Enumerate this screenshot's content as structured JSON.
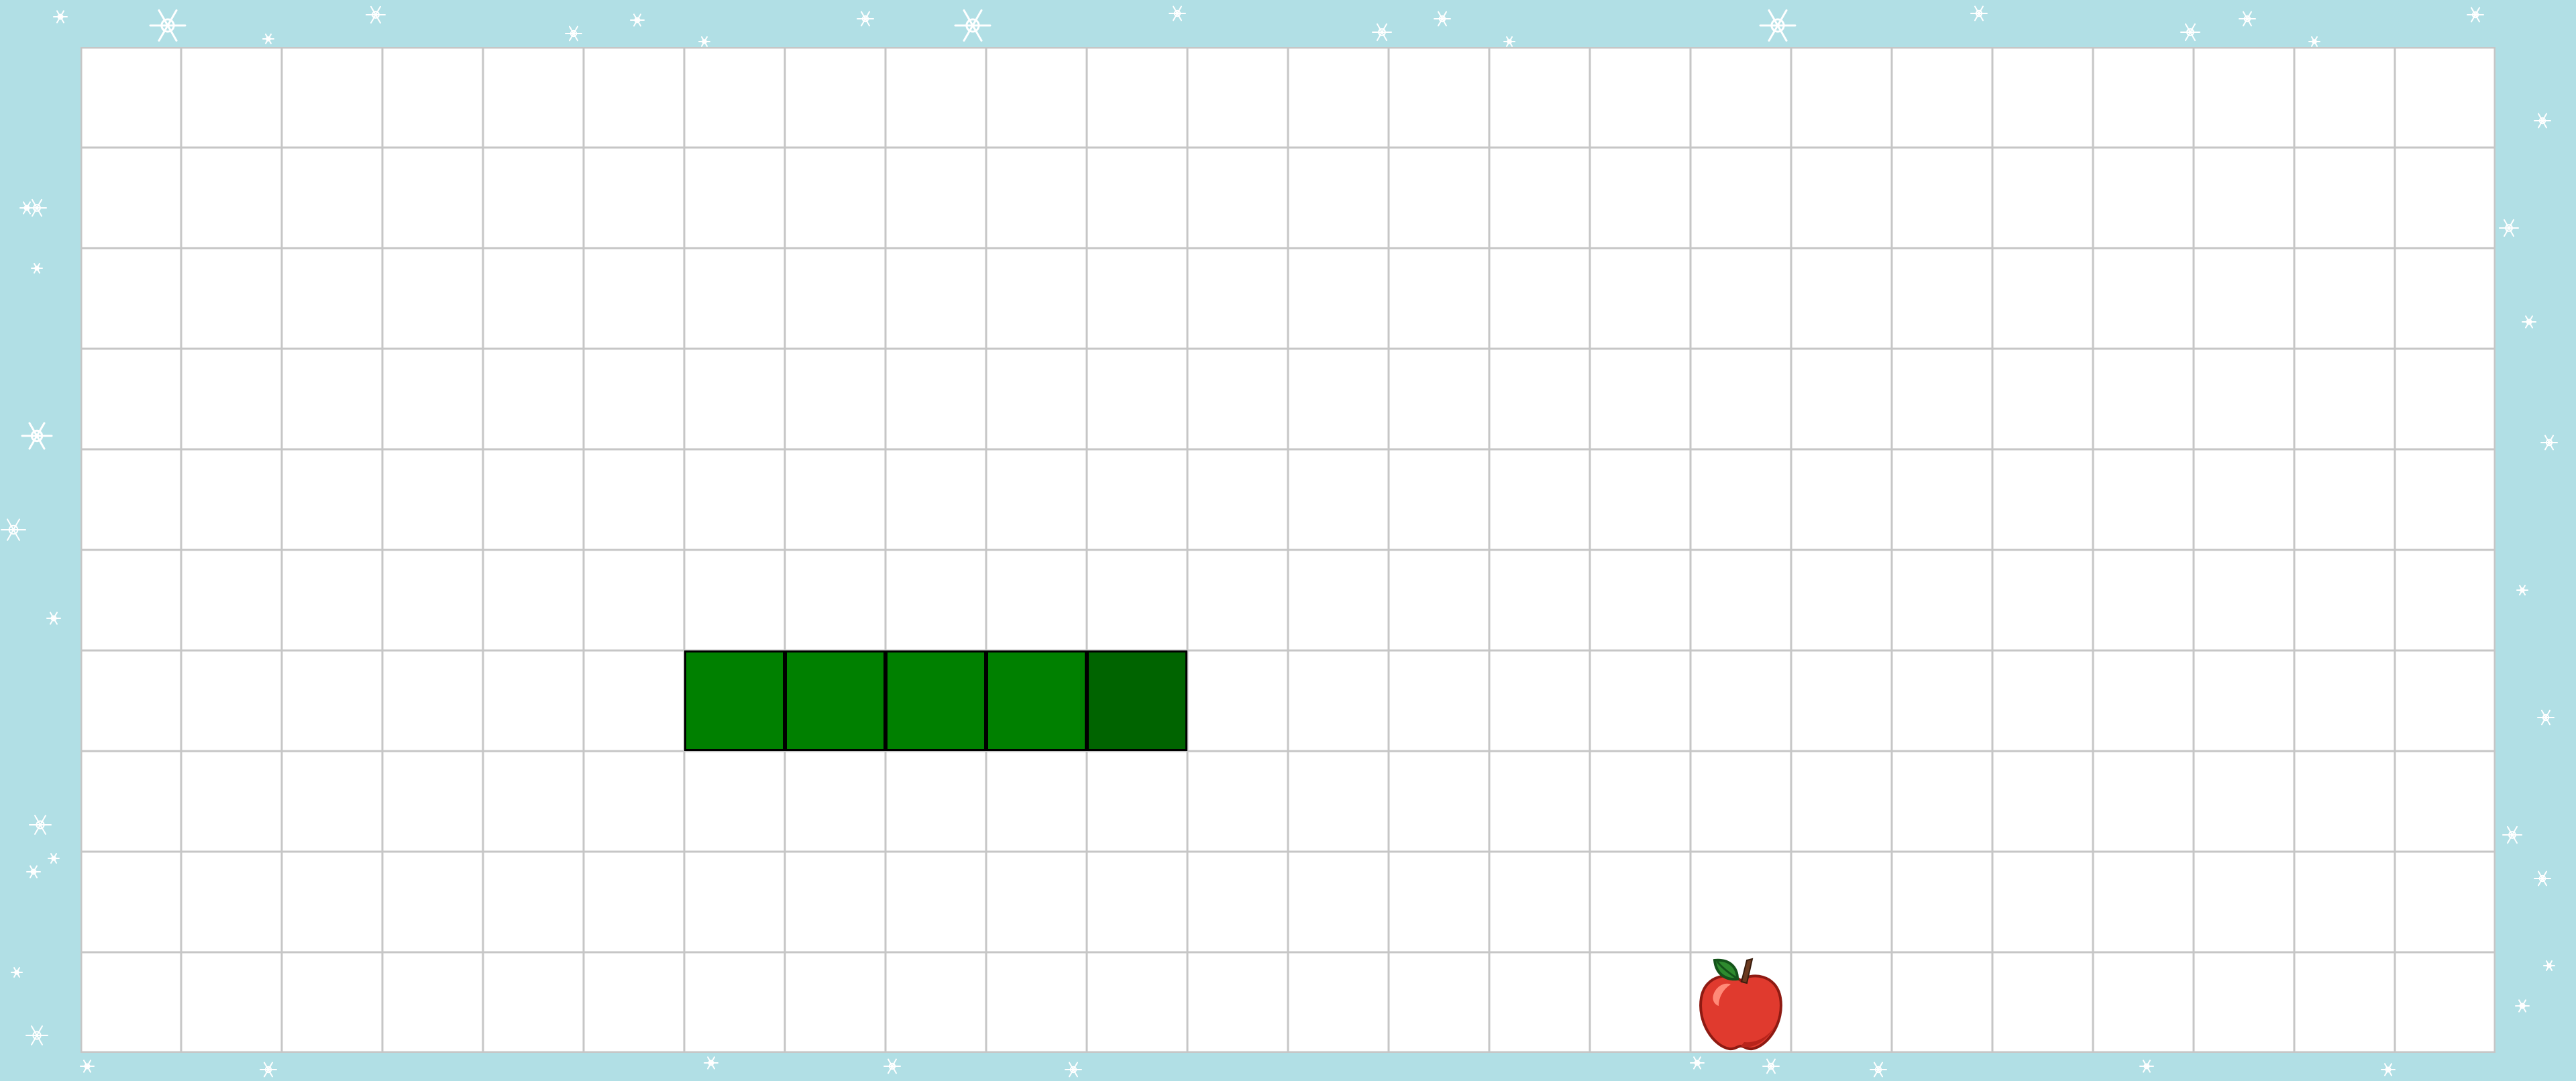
{
  "game": {
    "board": {
      "columns": 24,
      "rows": 10,
      "background": "#ffffff",
      "grid_color": "#c6c6c6"
    },
    "frame": {
      "background": "#b1dfe5",
      "decoration": "snowflake-icon",
      "decoration_color": "#ffffff"
    },
    "snake": {
      "direction": "right",
      "head_color": "#006400",
      "body_color": "#008000",
      "outline_color": "#000000",
      "segments": [
        {
          "col": 6,
          "row": 6
        },
        {
          "col": 7,
          "row": 6
        },
        {
          "col": 8,
          "row": 6
        },
        {
          "col": 9,
          "row": 6
        },
        {
          "col": 10,
          "row": 6
        }
      ]
    },
    "food": {
      "type": "apple-icon",
      "col": 16,
      "row": 9,
      "color": "#e03a2e"
    }
  }
}
